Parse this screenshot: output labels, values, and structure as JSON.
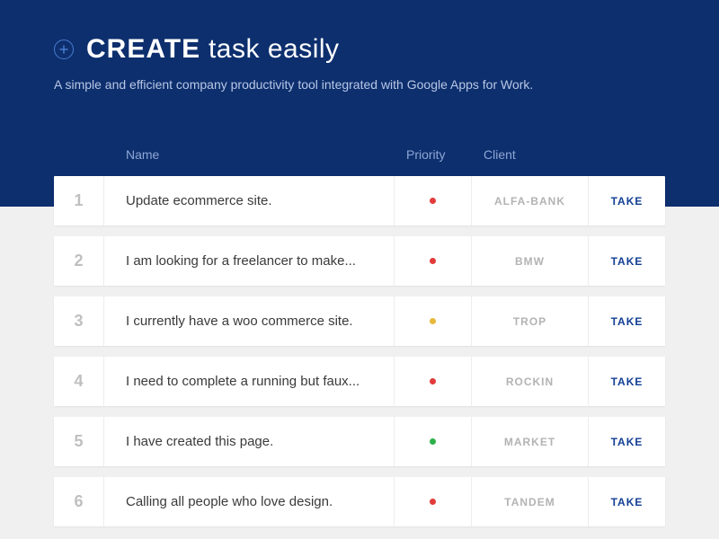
{
  "hero": {
    "title_bold": "CREATE",
    "title_light": "task easily",
    "subtitle": "A simple and efficient company productivity tool integrated with Google Apps for Work."
  },
  "columns": {
    "name": "Name",
    "priority": "Priority",
    "client": "Client"
  },
  "take_label": "TAKE",
  "priority_colors": {
    "red": "#e23b3b",
    "yellow": "#e7b93b",
    "green": "#2eb04a"
  },
  "tasks": [
    {
      "num": "1",
      "name": "Update ecommerce site.",
      "priority": "red",
      "client": "ALFA-BANK"
    },
    {
      "num": "2",
      "name": "I am looking for a freelancer to make...",
      "priority": "red",
      "client": "BMW"
    },
    {
      "num": "3",
      "name": "I currently have a woo commerce site.",
      "priority": "yellow",
      "client": "TROP"
    },
    {
      "num": "4",
      "name": "I need to complete a running but faux...",
      "priority": "red",
      "client": "ROCKIN"
    },
    {
      "num": "5",
      "name": "I have created this page.",
      "priority": "green",
      "client": "MARKET"
    },
    {
      "num": "6",
      "name": "Calling all people who love design.",
      "priority": "red",
      "client": "TANDEM"
    }
  ]
}
